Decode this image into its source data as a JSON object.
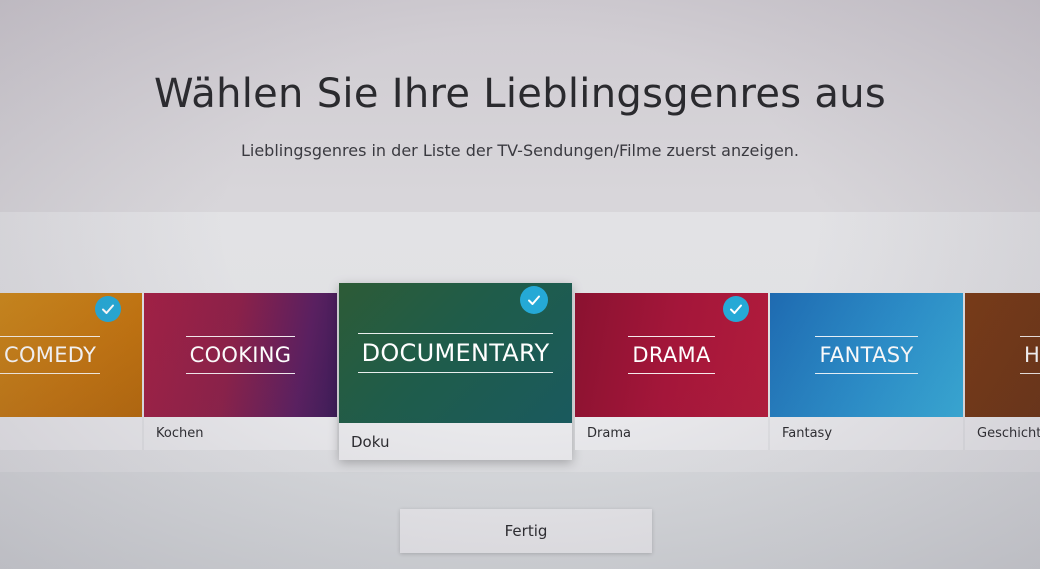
{
  "header": {
    "title": "Wählen Sie Ihre Lieblingsgenres aus",
    "subtitle": "Lieblingsgenres in der Liste der TV-Sendungen/Filme zuerst anzeigen."
  },
  "genres": [
    {
      "art_text": "COMEDY",
      "label": "",
      "selected": true,
      "color": "#c98216"
    },
    {
      "art_text": "COOKING",
      "label": "Kochen",
      "selected": false,
      "color": "#8b2149"
    },
    {
      "art_text": "DOCUMENTARY",
      "label": "Doku",
      "selected": true,
      "focused": true,
      "color": "#1f5c4a"
    },
    {
      "art_text": "DRAMA",
      "label": "Drama",
      "selected": true,
      "color": "#a4163a"
    },
    {
      "art_text": "FANTASY",
      "label": "Fantasy",
      "selected": false,
      "color": "#2a8fcb"
    },
    {
      "art_text": "HI",
      "label": "Geschichte",
      "selected": false,
      "color": "#6f3513"
    }
  ],
  "footer": {
    "done_label": "Fertig"
  },
  "accent_color": "#25a9d6",
  "icons": {
    "selected_check": "checkmark-icon"
  }
}
